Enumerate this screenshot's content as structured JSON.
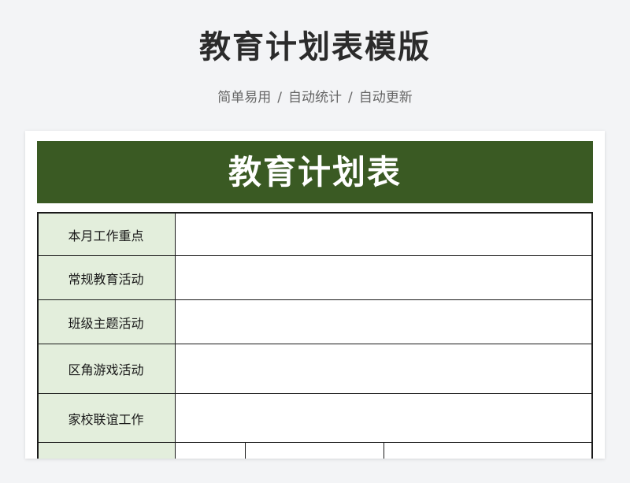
{
  "header": {
    "title": "教育计划表模版",
    "subtitle_items": [
      "简单易用",
      "自动统计",
      "自动更新"
    ],
    "separator": "/"
  },
  "sheet": {
    "title": "教育计划表",
    "header_bg": "#3a5a23",
    "label_bg": "#e3eedc",
    "rows": [
      {
        "label": "本月工作重点",
        "value": ""
      },
      {
        "label": "常规教育活动",
        "value": ""
      },
      {
        "label": "班级主题活动",
        "value": ""
      },
      {
        "label": "区角游戏活动",
        "value": ""
      },
      {
        "label": "家校联谊工作",
        "value": ""
      }
    ]
  }
}
